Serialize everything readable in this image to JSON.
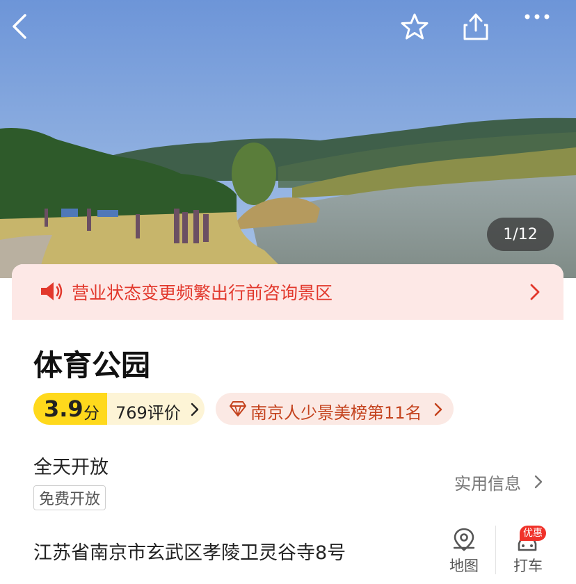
{
  "hero": {
    "photo_counter": "1/12",
    "icons": {
      "back": "back-arrow-icon",
      "favorite": "star-icon",
      "share": "share-icon",
      "more": "more-dots-icon"
    }
  },
  "notice": {
    "text": "营业状态变更频繁出行前咨询景区",
    "icon": "speaker-icon",
    "color": "#e2382c",
    "background": "#fde8e6"
  },
  "place": {
    "name": "体育公园",
    "score": "3.9",
    "score_unit": "分",
    "reviews": "769评价",
    "ranking": "南京人少景美榜第11名",
    "hours": "全天开放",
    "fee_tag": "免费开放",
    "practical_info": "实用信息",
    "address": "江苏省南京市玄武区孝陵卫灵谷寺8号"
  },
  "actions": {
    "map_label": "地图",
    "taxi_label": "打车",
    "taxi_badge": "优惠"
  },
  "colors": {
    "accent_yellow": "#ffd91c",
    "rank_text": "#c4431e"
  }
}
